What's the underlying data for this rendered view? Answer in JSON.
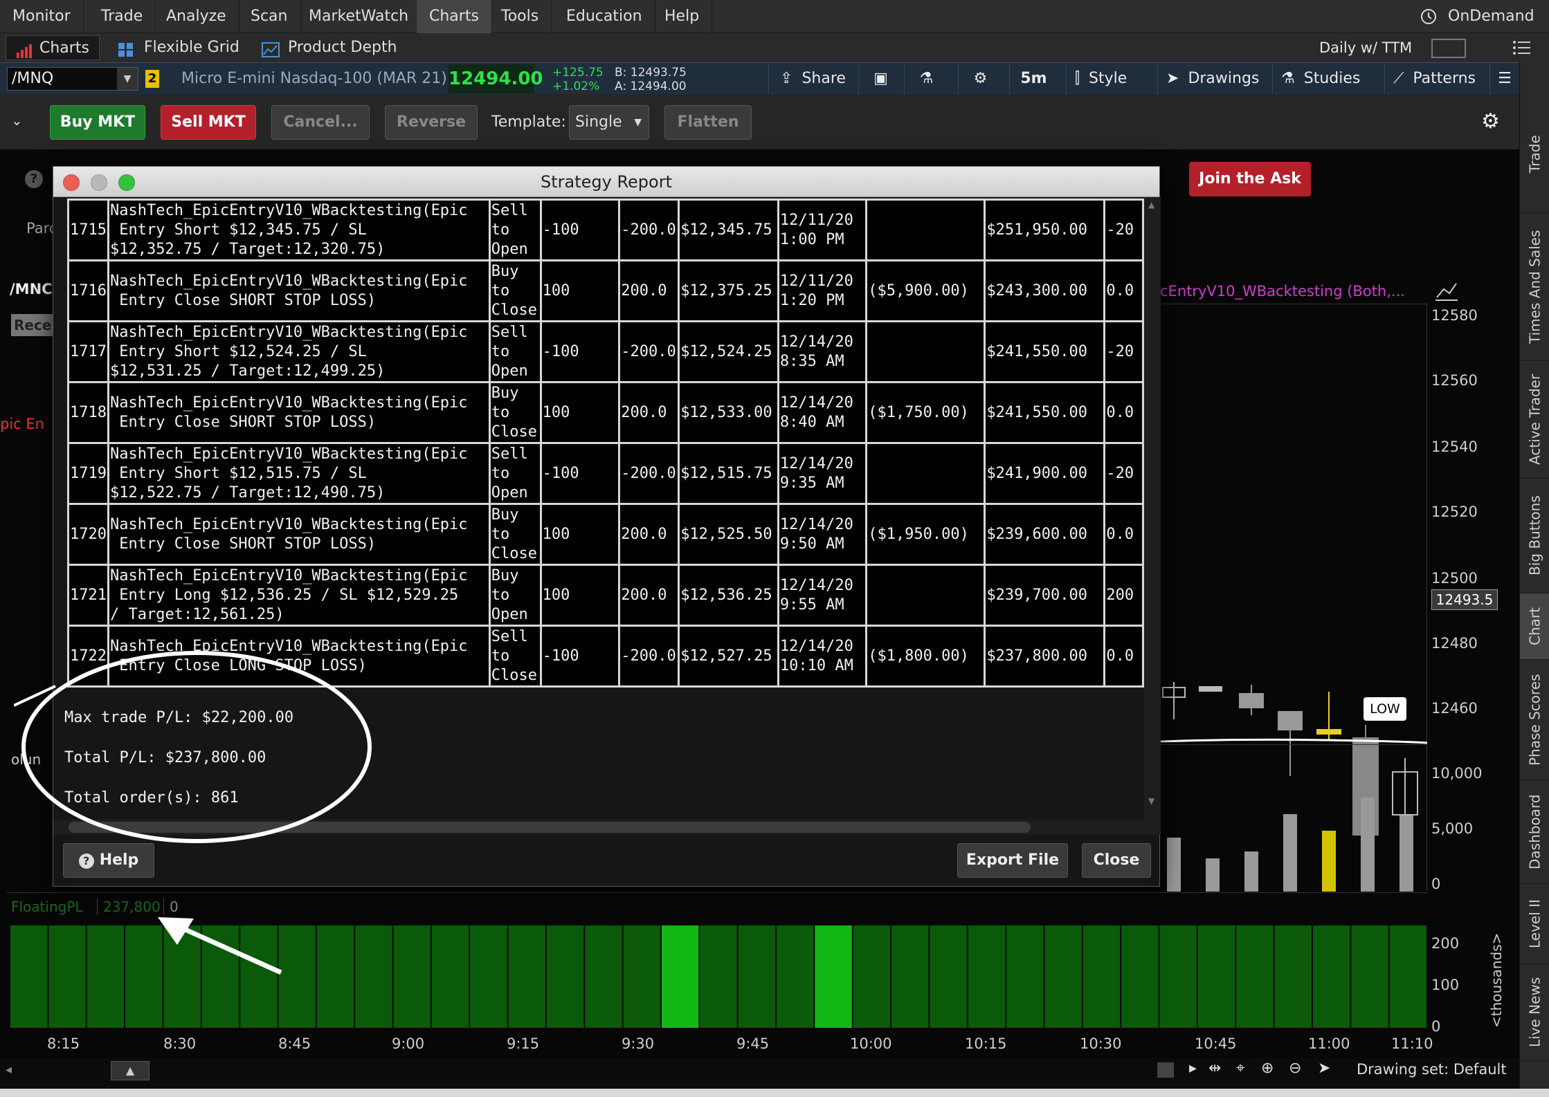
{
  "menu": [
    "Monitor",
    "Trade",
    "Analyze",
    "Scan",
    "MarketWatch",
    "Charts",
    "Tools",
    "Education",
    "Help"
  ],
  "menu_active": "Charts",
  "ondemand": "OnDemand",
  "subtabs": [
    "Charts",
    "Flexible Grid",
    "Product Depth"
  ],
  "aggregation": "Daily w/ TTM",
  "symbol": {
    "ticker": "/MNQ",
    "link": "2",
    "name": "Micro E-mini Nasdaq-100 (MAR 21)",
    "last": "12494.00",
    "change": "+125.75",
    "change_pct": "+1.02%",
    "bid": "B: 12493.75",
    "ask": "A: 12494.00"
  },
  "toolbar": {
    "share": "Share",
    "timeframe": "5m",
    "style": "Style",
    "drawings": "Drawings",
    "studies": "Studies",
    "patterns": "Patterns"
  },
  "orders": {
    "buy": "Buy MKT",
    "sell": "Sell MKT",
    "cancel": "Cancel...",
    "reverse": "Reverse",
    "template_label": "Template:",
    "template_value": "Single",
    "flatten": "Flatten",
    "join_ask": "Join the Ask"
  },
  "chart_panel": {
    "symbol_label": "/MNC",
    "study_label": "cEntryV10_WBacktesting (Both,...",
    "side_label_param": "Parc",
    "side_label_recent": "Rece",
    "side_label_epic": "pic En",
    "volume_label": "olun",
    "price_ticks": [
      "12580",
      "12560",
      "12540",
      "12520",
      "12500",
      "12480",
      "12460"
    ],
    "price_marker": "12493.5",
    "low_marker": "LOW",
    "volume_ticks": [
      "10,000",
      "5,000",
      "0"
    ],
    "floatingpl_label": "FloatingPL",
    "floatingpl_value": "237,800",
    "floatingpl_zero": "0",
    "pl_ticks": [
      "200",
      "100",
      "0"
    ],
    "pl_unit": "<thousands>",
    "time_ticks": [
      "8:15",
      "8:30",
      "8:45",
      "9:00",
      "9:15",
      "9:30",
      "9:45",
      "10:00",
      "10:15",
      "10:30",
      "10:45",
      "11:00",
      "11:10"
    ],
    "drawing_set": "Drawing set: Default"
  },
  "sidebar": [
    "Trade",
    "Times And Sales",
    "Active Trader",
    "Big Buttons",
    "Chart",
    "Phase Scores",
    "Dashboard",
    "Level II",
    "Live News"
  ],
  "sidebar_active": "Chart",
  "dialog": {
    "title": "Strategy Report",
    "rows": [
      [
        "1715",
        "NashTech_EpicEntryV10_WBacktesting(Epic\n Entry Short $12,345.75 / SL\n$12,352.75 / Target:12,320.75)",
        "Sell\nto\nOpen",
        "-100",
        "-200.0",
        "$12,345.75",
        "12/11/20\n1:00 PM",
        "",
        "$251,950.00",
        "-20"
      ],
      [
        "1716",
        "NashTech_EpicEntryV10_WBacktesting(Epic\n Entry Close SHORT STOP LOSS)",
        "Buy\nto\nClose",
        "100",
        "200.0",
        "$12,375.25",
        "12/11/20\n1:20 PM",
        "($5,900.00)",
        "$243,300.00",
        "0.0"
      ],
      [
        "1717",
        "NashTech_EpicEntryV10_WBacktesting(Epic\n Entry Short $12,524.25 / SL\n$12,531.25 / Target:12,499.25)",
        "Sell\nto\nOpen",
        "-100",
        "-200.0",
        "$12,524.25",
        "12/14/20\n8:35 AM",
        "",
        "$241,550.00",
        "-20"
      ],
      [
        "1718",
        "NashTech_EpicEntryV10_WBacktesting(Epic\n Entry Close SHORT STOP LOSS)",
        "Buy\nto\nClose",
        "100",
        "200.0",
        "$12,533.00",
        "12/14/20\n8:40 AM",
        "($1,750.00)",
        "$241,550.00",
        "0.0"
      ],
      [
        "1719",
        "NashTech_EpicEntryV10_WBacktesting(Epic\n Entry Short $12,515.75 / SL\n$12,522.75 / Target:12,490.75)",
        "Sell\nto\nOpen",
        "-100",
        "-200.0",
        "$12,515.75",
        "12/14/20\n9:35 AM",
        "",
        "$241,900.00",
        "-20"
      ],
      [
        "1720",
        "NashTech_EpicEntryV10_WBacktesting(Epic\n Entry Close SHORT STOP LOSS)",
        "Buy\nto\nClose",
        "100",
        "200.0",
        "$12,525.50",
        "12/14/20\n9:50 AM",
        "($1,950.00)",
        "$239,600.00",
        "0.0"
      ],
      [
        "1721",
        "NashTech_EpicEntryV10_WBacktesting(Epic\n Entry Long $12,536.25 / SL $12,529.25\n/ Target:12,561.25)",
        "Buy\nto\nOpen",
        "100",
        "200.0",
        "$12,536.25",
        "12/14/20\n9:55 AM",
        "",
        "$239,700.00",
        "200"
      ],
      [
        "1722",
        "NashTech_EpicEntryV10_WBacktesting(Epic\n Entry Close LONG STOP LOSS)",
        "Sell\nto\nClose",
        "-100",
        "-200.0",
        "$12,527.25",
        "12/14/20\n10:10 AM",
        "($1,800.00)",
        "$237,800.00",
        "0.0"
      ]
    ],
    "max_trade_pl": "Max trade P/L: $22,200.00",
    "total_pl": "Total P/L: $237,800.00",
    "total_orders": "Total order(s): 861",
    "help": "Help",
    "export": "Export File",
    "close": "Close"
  }
}
